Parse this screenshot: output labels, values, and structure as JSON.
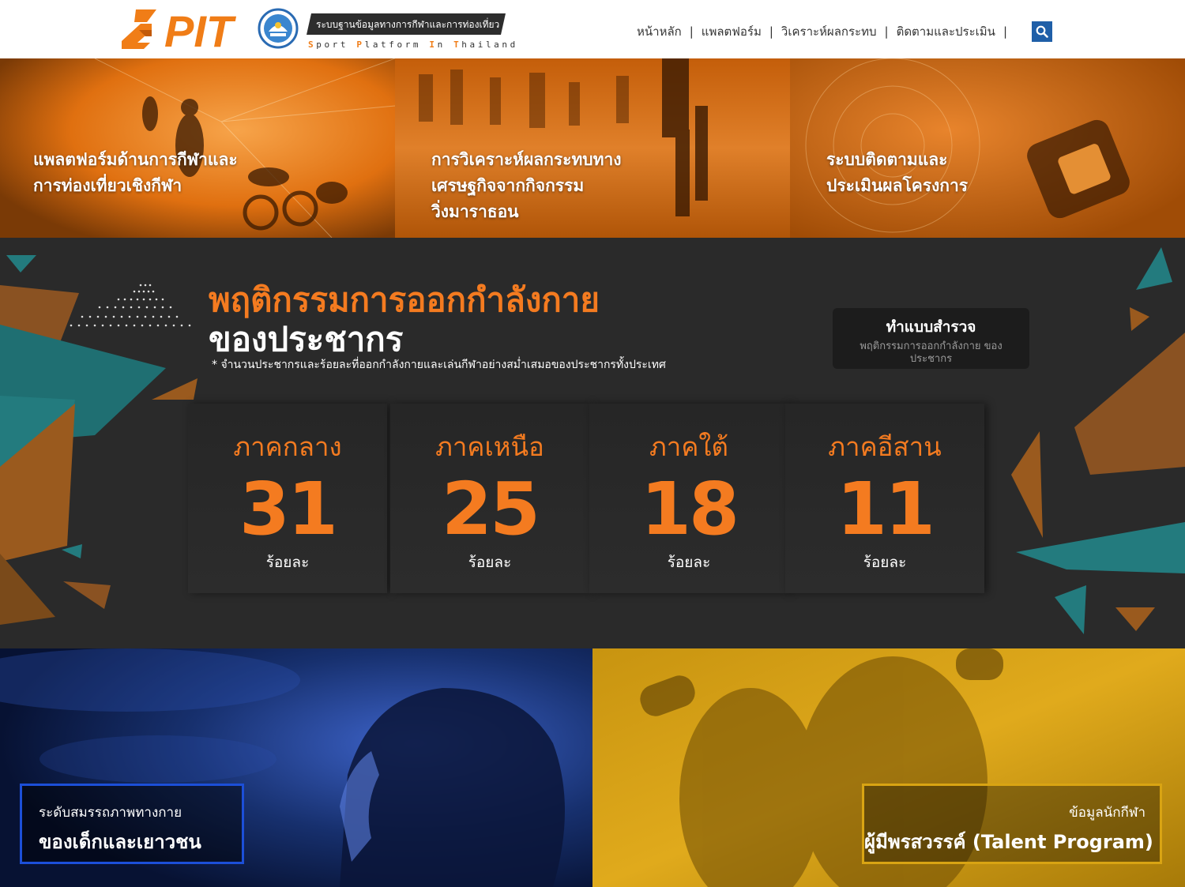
{
  "header": {
    "tagline": "ระบบฐานข้อมูลทางการกีฬาและการท่องเที่ยว",
    "sub_tagline_parts": [
      {
        "text": "S",
        "hl": true
      },
      {
        "text": "port ",
        "hl": false
      },
      {
        "text": "P",
        "hl": true
      },
      {
        "text": "latform ",
        "hl": false
      },
      {
        "text": "I",
        "hl": true
      },
      {
        "text": "n ",
        "hl": false
      },
      {
        "text": "T",
        "hl": true
      },
      {
        "text": "hailand",
        "hl": false
      }
    ],
    "nav": [
      "หน้าหลัก",
      "แพลตฟอร์ม",
      "วิเคราะห์ผลกระทบ",
      "ติดตามและประเมิน"
    ],
    "separator": "|",
    "search_icon": "search-icon",
    "logo_text": "PIT",
    "accent": "#f07d17",
    "search_color": "#1f5fa8"
  },
  "tiles": [
    {
      "lines": [
        "แพลตฟอร์มด้านการกีฬาและ",
        "การท่องเที่ยวเชิงกีฬา"
      ]
    },
    {
      "lines": [
        "การวิเคราะห์ผลกระทบทาง",
        "เศรษฐกิจจากกิจกรรม",
        "วิ่งมาราธอน"
      ]
    },
    {
      "lines": [
        "ระบบติดตามและ",
        "ประเมินผลโครงการ"
      ]
    }
  ],
  "stats": {
    "title": "พฤติกรรมการออกกำลังกาย",
    "subtitle": "ของประชากร",
    "note": "* จำนวนประชากรและร้อยละที่ออกกำลังกายและเล่นกีฬาอย่างสม่ำเสมอของประชากรทั้งประเทศ",
    "survey": {
      "title": "ทำแบบสำรวจ",
      "desc": "พฤติกรรมการออกกำลังกาย ของประชากร"
    },
    "regions": [
      {
        "name": "ภาคกลาง",
        "value": "31",
        "unit": "ร้อยละ"
      },
      {
        "name": "ภาคเหนือ",
        "value": "25",
        "unit": "ร้อยละ"
      },
      {
        "name": "ภาคใต้",
        "value": "18",
        "unit": "ร้อยละ"
      },
      {
        "name": "ภาคอีสาน",
        "value": "11",
        "unit": "ร้อยละ"
      }
    ],
    "accent": "#f47b20"
  },
  "panels": {
    "fitness": {
      "small": "ระดับสมรรถภาพทางกาย",
      "big": "ของเด็กและเยาวชน",
      "border": "#1c4fd8"
    },
    "talent": {
      "small": "ข้อมูลนักกีฬา",
      "big": "ผู้มีพรสวรรค์ (Talent Program)",
      "border": "#d9a413"
    }
  }
}
